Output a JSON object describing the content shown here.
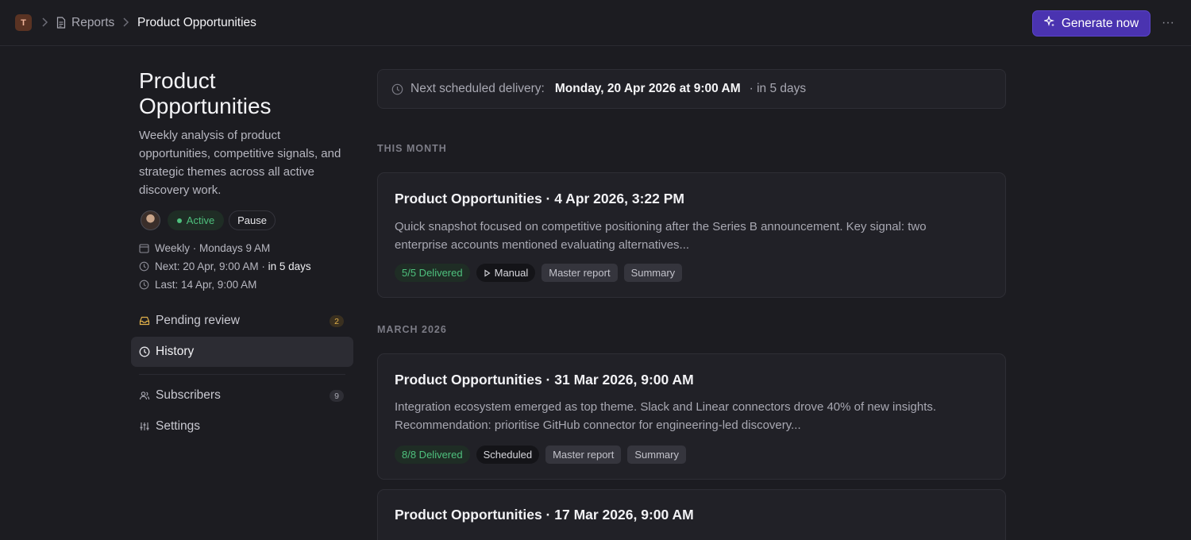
{
  "topbar": {
    "workspace_initial": "T",
    "breadcrumb_parent": "Reports",
    "breadcrumb_current": "Product Opportunities",
    "generate_label": "Generate now",
    "more_label": "···"
  },
  "sidebar": {
    "title": "Product Opportunities",
    "description": "Weekly analysis of product opportunities, competitive signals, and strategic themes across all active discovery work.",
    "status_label": "Active",
    "pause_label": "Pause",
    "schedule_text": "Weekly · Mondays 9 AM",
    "next_prefix": "Next: 20 Apr, 9:00 AM · ",
    "next_relative": "in 5 days",
    "last_text": "Last: 14 Apr, 9:00 AM",
    "nav": [
      {
        "label": "Pending review",
        "count": "2"
      },
      {
        "label": "History"
      },
      {
        "label": "Subscribers",
        "count": "9"
      },
      {
        "label": "Settings"
      }
    ]
  },
  "next_delivery": {
    "label": "Next scheduled delivery:",
    "date": "Monday, 20 Apr 2026 at 9:00 AM",
    "relative": "· in 5 days"
  },
  "sections": [
    {
      "heading": "THIS MONTH",
      "reports": [
        {
          "title": "Product Opportunities · 4 Apr 2026, 3:22 PM",
          "summary": "Quick snapshot focused on competitive positioning after the Series B announcement. Key signal: two enterprise accounts mentioned evaluating alternatives...",
          "delivered": "5/5 Delivered",
          "trigger": "Manual",
          "tags": [
            "Master report",
            "Summary"
          ]
        }
      ]
    },
    {
      "heading": "MARCH 2026",
      "reports": [
        {
          "title": "Product Opportunities · 31 Mar 2026, 9:00 AM",
          "summary": "Integration ecosystem emerged as top theme. Slack and Linear connectors drove 40% of new insights. Recommendation: prioritise GitHub connector for engineering-led discovery...",
          "delivered": "8/8 Delivered",
          "trigger": "Scheduled",
          "tags": [
            "Master report",
            "Summary"
          ]
        },
        {
          "title": "Product Opportunities · 17 Mar 2026, 9:00 AM"
        }
      ]
    }
  ],
  "colors": {
    "background": "#1c1c21",
    "accent": "#4a33b0",
    "success": "#4ec07d",
    "warning": "#e0b04a"
  }
}
